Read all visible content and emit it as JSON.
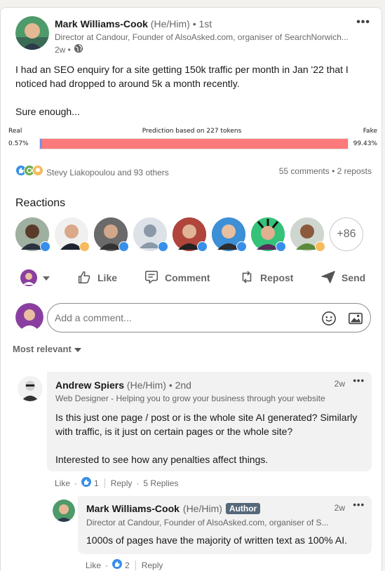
{
  "post": {
    "author": {
      "name": "Mark Williams-Cook",
      "pronouns": "(He/Him)",
      "degree": "• 1st",
      "headline": "Director at Candour, Founder of AlsoAsked.com, organiser of SearchNorwich...",
      "time": "2w •"
    },
    "menu_icon": "more-icon",
    "text_line1": "I had an SEO enquiry for a site getting 150k traffic per month in Jan '22 that I",
    "text_line2": "noticed had dropped to around 5k a month recently.",
    "text_line3": "Sure enough..."
  },
  "prediction": {
    "real_label": "Real",
    "fake_label": "Fake",
    "title": "Prediction based on 227 tokens",
    "real_pct": "0.57%",
    "fake_pct": "99.43%",
    "real_fraction": 0.0057,
    "real_color": "#7b8fe0",
    "fake_color": "#ff7a7a"
  },
  "social": {
    "reactors": "Stevy Liakopoulou and 93 others",
    "comments": "55 comments",
    "reposts": "• 2 reposts"
  },
  "reactions": {
    "heading": "Reactions",
    "more_count": "+86"
  },
  "actions": {
    "like": "Like",
    "comment": "Comment",
    "repost": "Repost",
    "send": "Send"
  },
  "comment_box": {
    "placeholder": "Add a comment..."
  },
  "sort": {
    "label": "Most relevant"
  },
  "comments": [
    {
      "name": "Andrew Spiers",
      "pronouns": "(He/Him)",
      "degree": "• 2nd",
      "headline": "Web Designer - Helping you to grow your business through your website",
      "time": "2w",
      "text_line1": "Is this just one page / post or is the whole site AI generated? Similarly",
      "text_line2": "with traffic, is it just on certain pages or the whole site?",
      "text_line3": "Interested to see how any penalties affect things.",
      "like_label": "Like",
      "like_count": "1",
      "reply_label": "Reply",
      "replies": "5 Replies"
    }
  ],
  "reply": {
    "name": "Mark Williams-Cook",
    "pronouns": "(He/Him)",
    "badge": "Author",
    "headline": "Director at Candour, Founder of AlsoAsked.com, organiser of S...",
    "time": "2w",
    "text": "1000s of pages have the majority of written text as 100% AI.",
    "like_label": "Like",
    "like_count": "2",
    "reply_label": "Reply"
  },
  "colors": {
    "like_blue": "#378fe9",
    "border": "#dcdcdc"
  }
}
